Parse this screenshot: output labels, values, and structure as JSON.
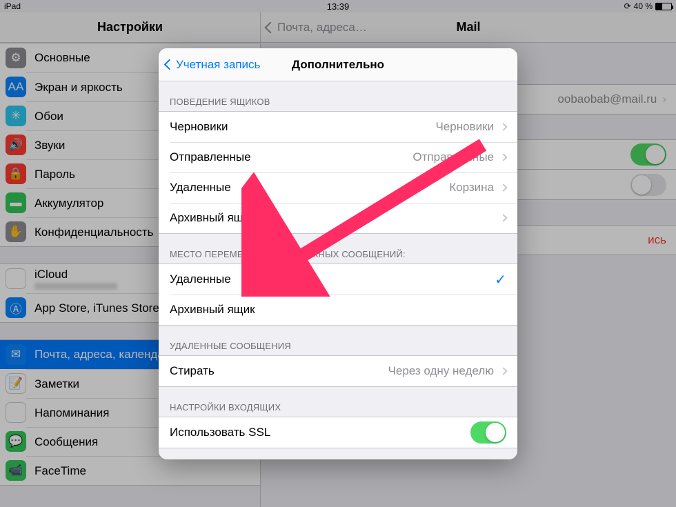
{
  "status": {
    "device": "iPad",
    "time": "13:39",
    "battery_pct": "40 %",
    "orientation_icon": "orientation-lock"
  },
  "left_title": "Настройки",
  "sidebar_groups": [
    {
      "items": [
        {
          "icon": "gear-icon",
          "bg": "bg-gray",
          "label": "Основные"
        },
        {
          "icon": "text-size-icon",
          "bg": "bg-blue",
          "label": "Экран и яркость"
        },
        {
          "icon": "wallpaper-icon",
          "bg": "bg-cyan",
          "label": "Обои"
        },
        {
          "icon": "sound-icon",
          "bg": "bg-red",
          "label": "Звуки"
        },
        {
          "icon": "lock-icon",
          "bg": "bg-red",
          "label": "Пароль"
        },
        {
          "icon": "battery-icon",
          "bg": "bg-green",
          "label": "Аккумулятор"
        },
        {
          "icon": "hand-icon",
          "bg": "bg-gray",
          "label": "Конфиденциальность"
        }
      ]
    },
    {
      "items": [
        {
          "icon": "cloud-icon",
          "bg": "bg-white",
          "label": "iCloud",
          "sub": true
        },
        {
          "icon": "appstore-icon",
          "bg": "bg-blue",
          "label": "App Store, iTunes Store"
        }
      ]
    },
    {
      "items": [
        {
          "icon": "mail-icon",
          "bg": "bg-blue",
          "label": "Почта, адреса, календари",
          "selected": true
        },
        {
          "icon": "notes-icon",
          "bg": "",
          "label": "Заметки"
        },
        {
          "icon": "reminders-icon",
          "bg": "",
          "label": "Напоминания"
        },
        {
          "icon": "messages-icon",
          "bg": "bg-green",
          "label": "Сообщения"
        },
        {
          "icon": "facetime-icon",
          "bg": "bg-green",
          "label": "FaceTime"
        }
      ]
    }
  ],
  "right": {
    "back_label": "Почта, адреса…",
    "title": "Mail",
    "account_email": "oobaobab@mail.ru",
    "delete_label": "ись"
  },
  "modal": {
    "back_label": "Учетная запись",
    "title": "Дополнительно",
    "section1_header": "ПОВЕДЕНИЕ ЯЩИКОВ",
    "section1": [
      {
        "label": "Черновики",
        "value": "Черновики"
      },
      {
        "label": "Отправленные",
        "value": "Отправленные"
      },
      {
        "label": "Удаленные",
        "value": "Корзина"
      },
      {
        "label": "Архивный ящик",
        "value": ""
      }
    ],
    "section2_header": "МЕСТО ПЕРЕМЕЩЕНИЯ НЕНУЖНЫХ СООБЩЕНИЙ:",
    "section2_header_visible_left": "МЕСТО ПЕРЕМЕЩЕНИ",
    "section2_header_visible_right": "ЖНЫХ СООБЩЕНИЙ:",
    "section2": [
      {
        "label": "Удаленные",
        "checked": true
      },
      {
        "label": "Архивный ящик",
        "checked": false
      }
    ],
    "section3_header": "УДАЛЕННЫЕ СООБЩЕНИЯ",
    "section3": [
      {
        "label": "Стирать",
        "value": "Через одну неделю"
      }
    ],
    "section4_header": "НАСТРОЙКИ ВХОДЯЩИХ",
    "section4": [
      {
        "label": "Использовать SSL",
        "switch": true
      }
    ]
  }
}
